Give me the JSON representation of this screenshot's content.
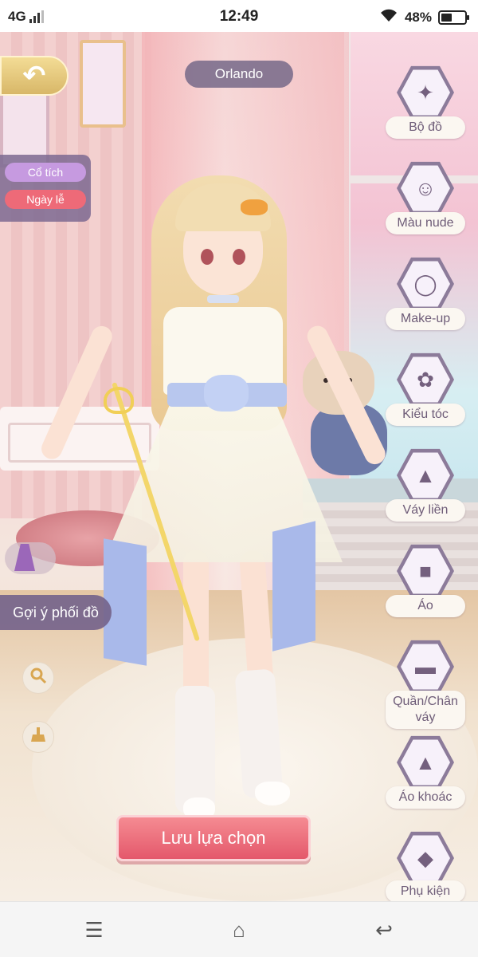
{
  "status_bar": {
    "network": "4G",
    "time": "12:49",
    "battery_percent": "48%",
    "battery_level": 0.48,
    "icons": [
      "signal-icon",
      "wifi-icon",
      "battery-icon"
    ]
  },
  "header": {
    "back_icon": "back-arrow-icon",
    "character_name": "Orlando"
  },
  "tags": [
    {
      "label": "Cổ tích",
      "color": "#c69ae0"
    },
    {
      "label": "Ngày lễ",
      "color": "#ee6a78"
    }
  ],
  "left_controls": {
    "suggest_label": "Gợi ý phối đồ",
    "zoom_icon": "magnifier-icon",
    "clean_icon": "broom-icon"
  },
  "save_button": {
    "label": "Lưu lựa chọn"
  },
  "right_menu": [
    {
      "label": "Bộ đồ",
      "icon": "outfit-icon"
    },
    {
      "label": "Màu nude",
      "icon": "face-icon"
    },
    {
      "label": "Make-up",
      "icon": "mirror-icon"
    },
    {
      "label": "Kiểu tóc",
      "icon": "hairstyle-icon"
    },
    {
      "label": "Váy liền",
      "icon": "dress-icon"
    },
    {
      "label": "Áo",
      "icon": "shirt-icon"
    },
    {
      "label": "Quần/Chân váy",
      "icon": "pants-skirt-icon"
    },
    {
      "label": "Áo khoác",
      "icon": "jacket-icon"
    },
    {
      "label": "Phụ kiện",
      "icon": "gem-icon"
    }
  ],
  "nav_bar": {
    "icons": [
      "menu-icon",
      "home-icon",
      "back-icon"
    ]
  },
  "colors": {
    "accent_purple": "#75648b",
    "save_pink": "#e4586b",
    "back_gold": "#d8b768"
  }
}
